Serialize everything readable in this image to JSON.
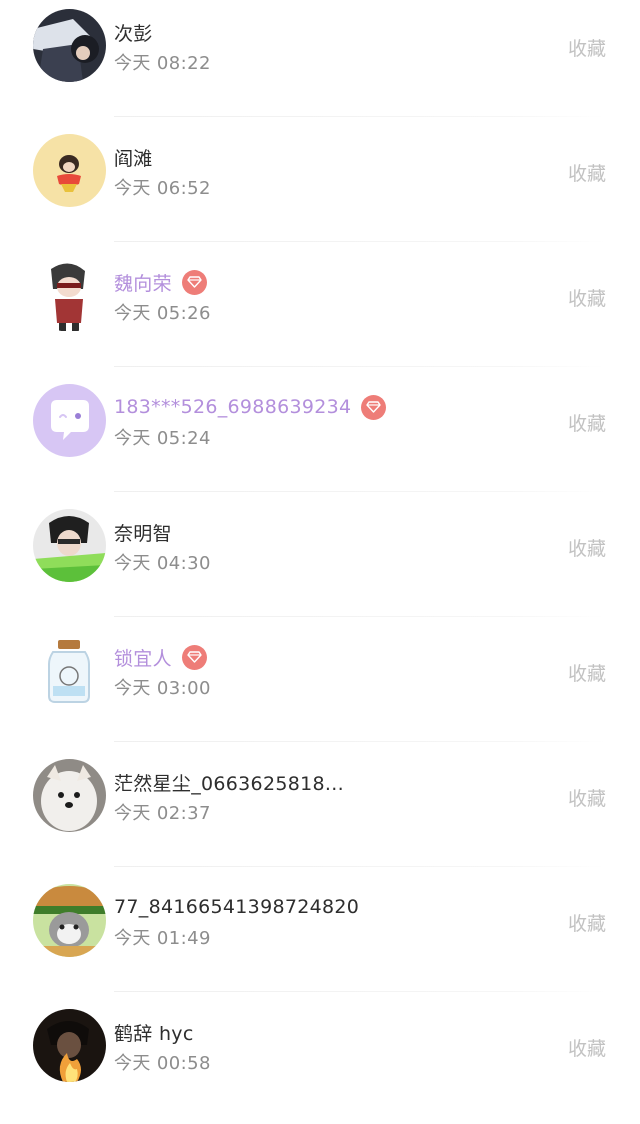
{
  "favorite_label": "收藏",
  "users": [
    {
      "name": "次彭",
      "time": "今天 08:22",
      "vip": false,
      "avatar": "avatar-photo-anime-icon"
    },
    {
      "name": "阎滩",
      "time": "今天 06:52",
      "vip": false,
      "avatar": "avatar-monkey-cartoon-icon"
    },
    {
      "name": "魏向荣",
      "time": "今天 05:26",
      "vip": true,
      "avatar": "avatar-cartoon-boy-icon"
    },
    {
      "name": "183***526_6988639234",
      "time": "今天 05:24",
      "vip": true,
      "avatar": "avatar-default-chat-bubble-icon"
    },
    {
      "name": "奈明智",
      "time": "今天 04:30",
      "vip": false,
      "avatar": "avatar-photo-person-icon"
    },
    {
      "name": "锁宜人",
      "time": "今天 03:00",
      "vip": true,
      "avatar": "avatar-jar-icon"
    },
    {
      "name": "茫然星尘_0663625818...",
      "time": "今天 02:37",
      "vip": false,
      "avatar": "avatar-dog-icon"
    },
    {
      "name": "77_84166541398724820",
      "time": "今天 01:49",
      "vip": false,
      "avatar": "avatar-cat-burger-icon"
    },
    {
      "name": "鹤辞 hyc",
      "time": "今天 00:58",
      "vip": false,
      "avatar": "avatar-photo-fire-icon"
    }
  ],
  "colors": {
    "vip_name": "#b38fdc",
    "name": "#2e2e2e",
    "time": "#8d8d8d",
    "favorite": "#c2c2c2",
    "gem_badge": "#ee7d78"
  }
}
